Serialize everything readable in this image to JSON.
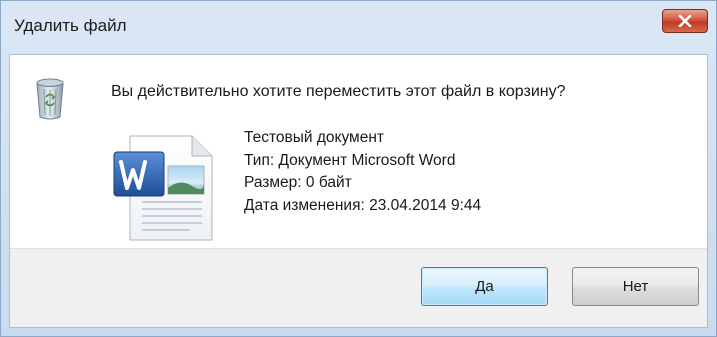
{
  "window": {
    "title": "Удалить файл",
    "close_icon": "close-icon"
  },
  "dialog": {
    "question": "Вы действительно хотите переместить этот файл в корзину?",
    "recycle_icon": "recycle-bin-icon",
    "file_icon": "word-document-icon",
    "file": {
      "name": "Тестовый документ",
      "type": "Тип: Документ Microsoft Word",
      "size": "Размер: 0 байт",
      "modified": "Дата изменения: 23.04.2014 9:44"
    }
  },
  "buttons": {
    "yes": "Да",
    "no": "Нет"
  },
  "colors": {
    "frame": "#c9dbef",
    "close_button": "#c03a22",
    "default_button_border": "#3c7fb1",
    "word_blue": "#2b579a"
  }
}
